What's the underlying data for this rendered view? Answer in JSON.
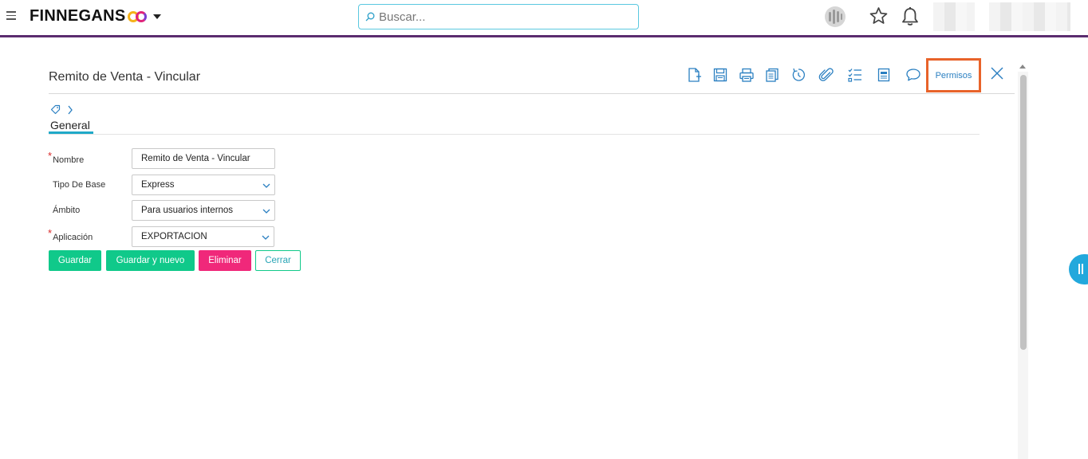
{
  "app": {
    "brand": "FINNEGANS",
    "search_placeholder": "Buscar..."
  },
  "form": {
    "title": "Remito de Venta - Vincular",
    "tab": "General",
    "permisos_label": "Permisos",
    "fields": [
      {
        "label": "Nombre",
        "required": true,
        "value": "Remito de Venta - Vincular",
        "type": "text"
      },
      {
        "label": "Tipo De Base",
        "required": false,
        "value": "Express",
        "type": "select"
      },
      {
        "label": "Ámbito",
        "required": false,
        "value": "Para usuarios internos",
        "type": "select"
      },
      {
        "label": "Aplicación",
        "required": true,
        "value": "EXPORTACION",
        "type": "select"
      }
    ],
    "buttons": {
      "save": "Guardar",
      "save_new": "Guardar y nuevo",
      "delete": "Eliminar",
      "close": "Cerrar"
    }
  },
  "toolbar_icons": [
    "new-document-icon",
    "save-icon",
    "print-icon",
    "copy-icon",
    "history-icon",
    "attachment-icon",
    "checklist-icon",
    "report-icon",
    "comment-icon"
  ],
  "colors": {
    "accent": "#20a9c8",
    "primary_button": "#10c98a",
    "danger_button": "#f0287a",
    "highlight": "#e8632a",
    "topline": "#5b2c6f"
  }
}
